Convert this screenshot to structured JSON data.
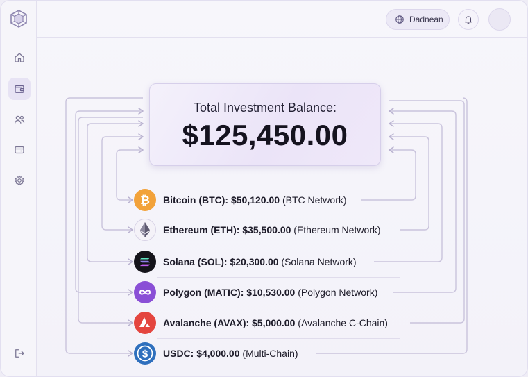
{
  "header": {
    "user_name": "Ɖadnean"
  },
  "sidebar": {
    "items": [
      {
        "icon": "home-icon"
      },
      {
        "icon": "wallet-icon"
      },
      {
        "icon": "users-icon"
      },
      {
        "icon": "card-icon"
      },
      {
        "icon": "settings-icon"
      },
      {
        "icon": "logout-icon"
      }
    ]
  },
  "balance": {
    "title": "Total Investment Balance:",
    "value": "$125,450.00"
  },
  "assets": [
    {
      "label": "Bitcoin (BTC): $50,120.00",
      "network": "(BTC Network)",
      "icon": "bitcoin-icon",
      "color": "#f2a23a"
    },
    {
      "label": "Ethereum (ETH): $35,500.00",
      "network": "(Ethereum Network)",
      "icon": "ethereum-icon",
      "color": "#f3f1f7"
    },
    {
      "label": "Solana (SOL): $20,300.00",
      "network": "(Solana Network)",
      "icon": "solana-icon",
      "color": "#15141b"
    },
    {
      "label": "Polygon (MATIC): $10,530.00",
      "network": "(Polygon Network)",
      "icon": "polygon-icon",
      "color": "#8a4fd6"
    },
    {
      "label": "Avalanche (AVAX): $5,000.00",
      "network": "(Avalanche C-Chain)",
      "icon": "avalanche-icon",
      "color": "#e4453f"
    },
    {
      "label": "USDC: $4,000.00",
      "network": "(Multi-Chain)",
      "icon": "usdc-icon",
      "color": "#2e6fbd"
    }
  ]
}
